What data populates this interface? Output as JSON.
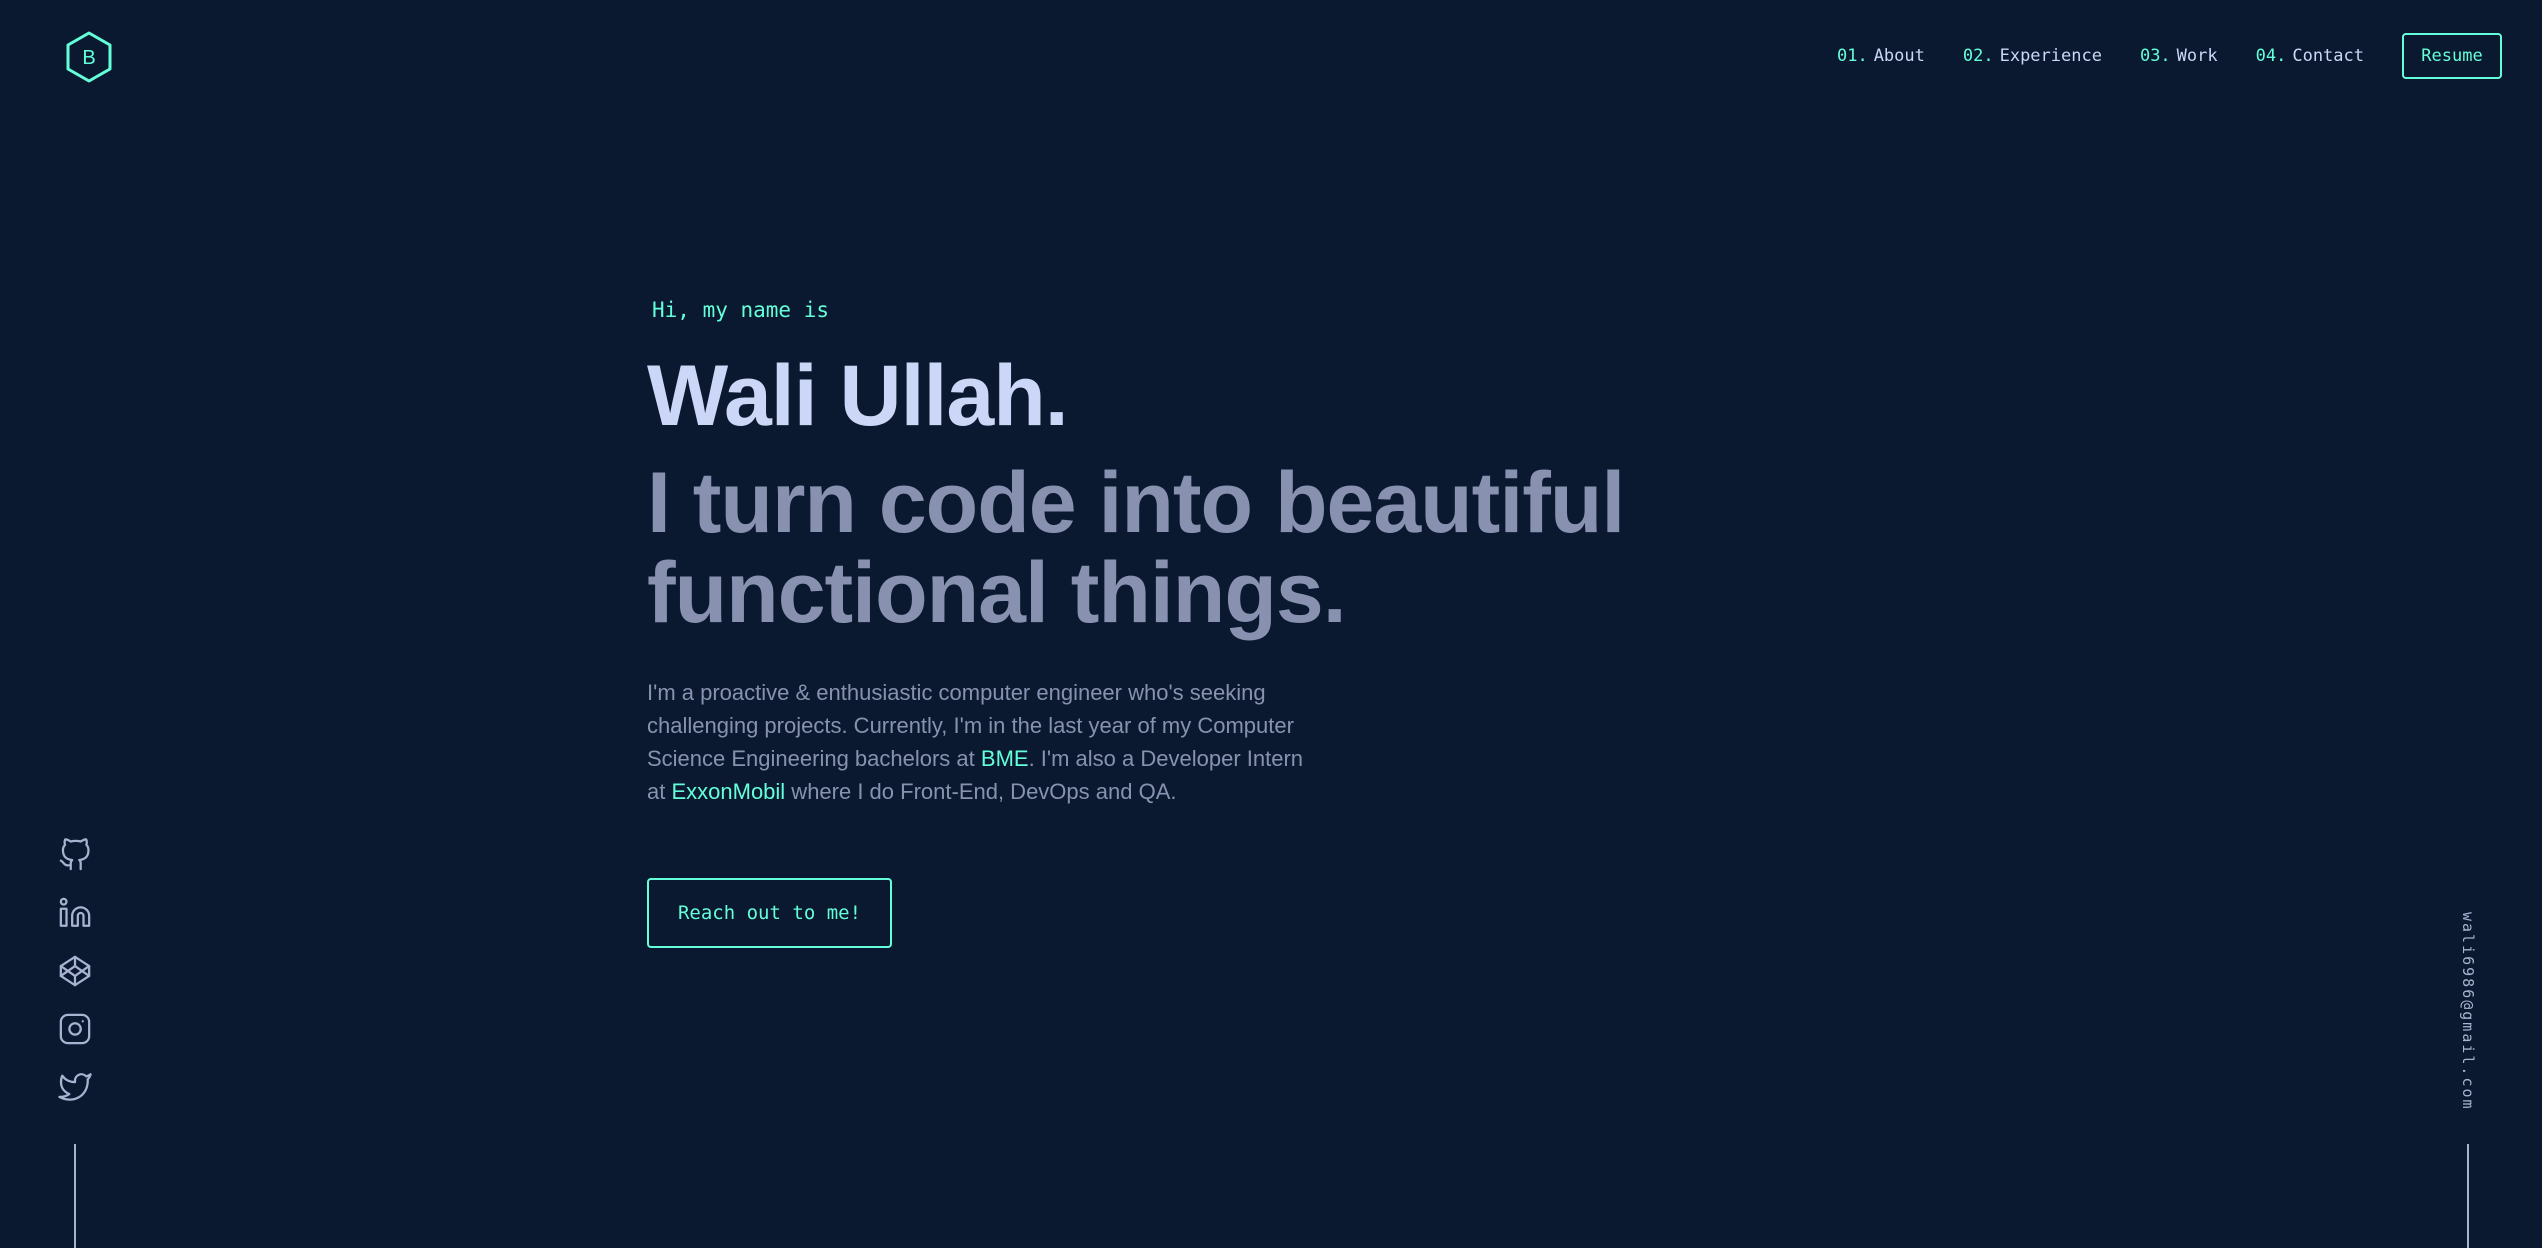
{
  "logo": {
    "letter": "B",
    "icon": "hexagon-logo-icon"
  },
  "nav": {
    "items": [
      {
        "num": "01.",
        "label": "About"
      },
      {
        "num": "02.",
        "label": "Experience"
      },
      {
        "num": "03.",
        "label": "Work"
      },
      {
        "num": "04.",
        "label": "Contact"
      }
    ],
    "resume_label": "Resume"
  },
  "hero": {
    "greeting": "Hi, my name is",
    "name": "Wali Ullah.",
    "tagline": "I turn code into beautiful functional things.",
    "bio": {
      "part1": "I'm a proactive & enthusiastic computer engineer who's seeking challenging projects. Currently, I'm in the last year of my Computer Science Engineering bachelors at ",
      "link1": "BME",
      "part2": ". I'm also a Developer Intern at ",
      "link2": "ExxonMobil",
      "part3": " where I do Front-End, DevOps and QA."
    },
    "cta_label": "Reach out to me!"
  },
  "social": [
    {
      "icon": "github-icon"
    },
    {
      "icon": "linkedin-icon"
    },
    {
      "icon": "codepen-icon"
    },
    {
      "icon": "instagram-icon"
    },
    {
      "icon": "twitter-icon"
    }
  ],
  "email": "wali6986@gmail.com",
  "colors": {
    "background": "#0a192f",
    "accent": "#64ffda",
    "heading": "#ccd6f6",
    "text": "#8892b0",
    "light": "#a8b2d1"
  }
}
